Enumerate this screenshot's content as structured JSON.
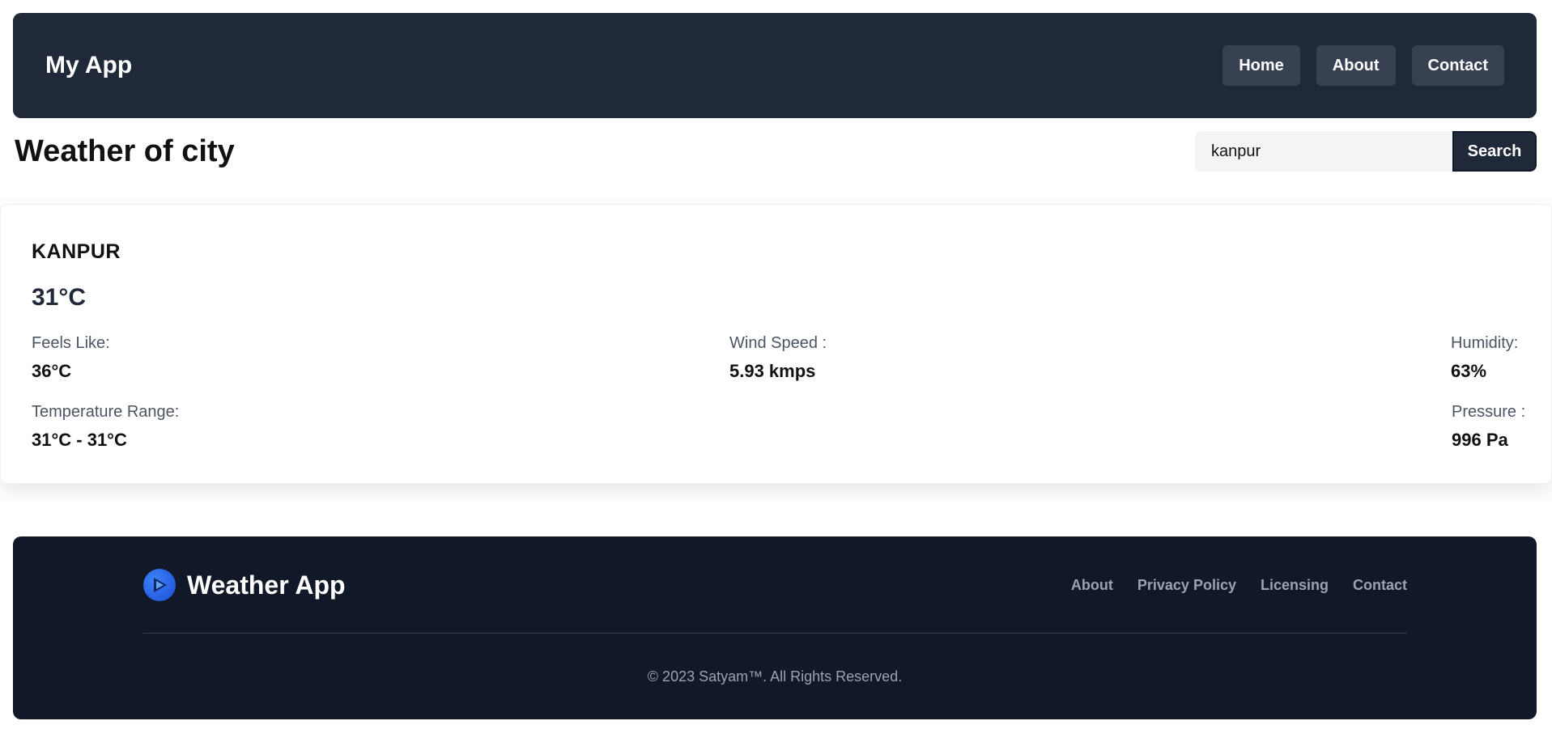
{
  "navbar": {
    "brand": "My App",
    "links": [
      "Home",
      "About",
      "Contact"
    ]
  },
  "page": {
    "title": "Weather of city"
  },
  "search": {
    "value": "kanpur",
    "button_label": "Search"
  },
  "weather": {
    "city": "KANPUR",
    "temperature": "31°C",
    "feels_like_label": "Feels Like:",
    "feels_like_value": "36°C",
    "temp_range_label": "Temperature Range:",
    "temp_range_value": "31°C - 31°C",
    "wind_label": "Wind Speed :",
    "wind_value": "5.93 kmps",
    "humidity_label": "Humidity:",
    "humidity_value": "63%",
    "pressure_label": "Pressure :",
    "pressure_value": "996 Pa"
  },
  "footer": {
    "brand": "Weather App",
    "links": [
      "About",
      "Privacy Policy",
      "Licensing",
      "Contact"
    ],
    "copyright": "© 2023 Satyam™. All Rights Reserved."
  },
  "colors": {
    "navbar_bg": "#1f2937",
    "footer_bg": "#111827",
    "logo_blue": "#2563eb"
  }
}
